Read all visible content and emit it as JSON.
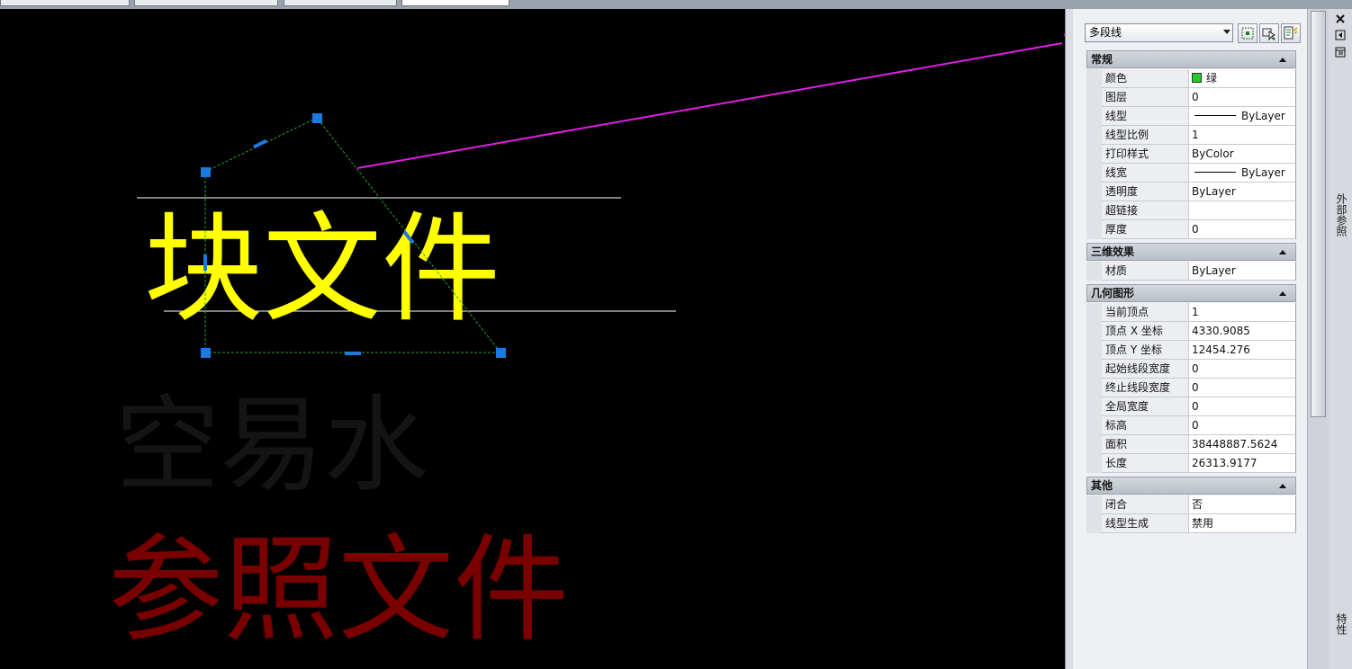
{
  "canvas": {
    "text_block": "块文件",
    "text_shx": "空易水",
    "text_xref": "参照文件",
    "colors": {
      "block_text": "#ffff00",
      "xref_text": "#7a0000",
      "faint_text": "#141414",
      "polyline": "#27a52f",
      "grip": "#1a7ae0",
      "leader": "#e11ee1"
    }
  },
  "palette": {
    "object_type": "多段线",
    "toolbar": {
      "quick_select_icon": "quick-select-icon",
      "select_objects_icon": "select-objects-icon",
      "pickadd_icon": "pickadd-toggle-icon"
    },
    "sections": [
      {
        "title": "常规",
        "rows": [
          {
            "name": "颜色",
            "value": "绿",
            "swatch": "#22cc22"
          },
          {
            "name": "图层",
            "value": "0"
          },
          {
            "name": "线型",
            "value": "ByLayer",
            "line_sample": true
          },
          {
            "name": "线型比例",
            "value": "1"
          },
          {
            "name": "打印样式",
            "value": "ByColor"
          },
          {
            "name": "线宽",
            "value": "ByLayer",
            "line_sample": true
          },
          {
            "name": "透明度",
            "value": "ByLayer"
          },
          {
            "name": "超链接",
            "value": ""
          },
          {
            "name": "厚度",
            "value": "0"
          }
        ]
      },
      {
        "title": "三维效果",
        "rows": [
          {
            "name": "材质",
            "value": "ByLayer"
          }
        ]
      },
      {
        "title": "几何图形",
        "rows": [
          {
            "name": "当前顶点",
            "value": "1"
          },
          {
            "name": "顶点 X 坐标",
            "value": "4330.9085"
          },
          {
            "name": "顶点 Y 坐标",
            "value": "12454.276"
          },
          {
            "name": "起始线段宽度",
            "value": "0"
          },
          {
            "name": "终止线段宽度",
            "value": "0"
          },
          {
            "name": "全局宽度",
            "value": "0"
          },
          {
            "name": "标高",
            "value": "0"
          },
          {
            "name": "面积",
            "value": "38448887.5624"
          },
          {
            "name": "长度",
            "value": "26313.9177"
          }
        ]
      },
      {
        "title": "其他",
        "rows": [
          {
            "name": "闭合",
            "value": "否"
          },
          {
            "name": "线型生成",
            "value": "禁用"
          }
        ]
      }
    ]
  },
  "side_strip": {
    "tab_xref": "外部参照",
    "tab_properties": "特性",
    "close_icon": "close-icon",
    "autohide_icon": "autohide-icon",
    "options_icon": "properties-options-icon"
  }
}
